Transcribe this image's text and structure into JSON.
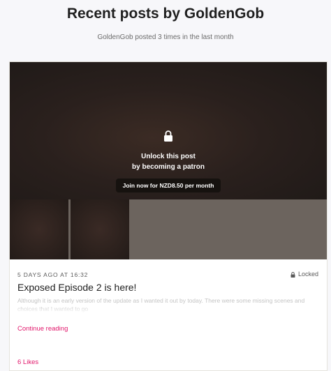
{
  "header": {
    "title": "Recent posts by GoldenGob",
    "subtitle": "GoldenGob posted 3 times in the last month"
  },
  "post": {
    "unlock_line1": "Unlock this post",
    "unlock_line2": "by becoming a patron",
    "join_label": "Join now for NZD8.50 per month",
    "timestamp": "5 DAYS AGO AT 16:32",
    "lock_status": "Locked",
    "title": "Exposed Episode 2 is here!",
    "excerpt": "Although it is an early version of the update as I wanted it out by today. There were some missing scenes and choices that I wanted to go",
    "continue_label": "Continue reading",
    "likes_label": "6 Likes",
    "icons": {
      "lock": "lock-icon",
      "lock_small": "lock-small-icon"
    }
  },
  "colors": {
    "accent": "#e1176b",
    "page_bg": "#f7f7fa",
    "media_dark": "#2a201d"
  }
}
